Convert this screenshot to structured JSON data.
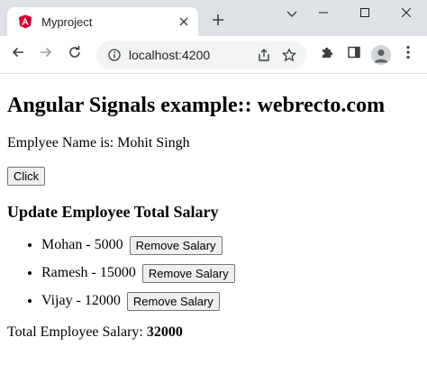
{
  "tab": {
    "title": "Myproject",
    "close_glyph": "✕",
    "favicon_icon": "angular-icon"
  },
  "new_tab": {
    "glyph": "+"
  },
  "window_controls": {
    "tab_search_icon": "chevron-down-icon",
    "minimize_icon": "minimize-icon",
    "maximize_icon": "maximize-icon",
    "close_icon": "close-icon"
  },
  "toolbar": {
    "url": "localhost:4200",
    "icons": [
      "back-icon",
      "forward-icon",
      "reload-icon",
      "info-icon",
      "share-icon",
      "star-icon",
      "extensions-icon",
      "side-panel-icon",
      "profile-icon",
      "menu-icon"
    ]
  },
  "page": {
    "heading": "Angular Signals example:: webrecto.com",
    "employee_label": "Emplyee Name is: Mohit Singh",
    "click_button": "Click",
    "subheading": "Update Employee Total Salary",
    "employees": [
      {
        "label": "Mohan - 5000",
        "button": "Remove Salary"
      },
      {
        "label": "Ramesh - 15000",
        "button": "Remove Salary"
      },
      {
        "label": "Vijay - 12000",
        "button": "Remove Salary"
      }
    ],
    "total_label": "Total Employee Salary: ",
    "total_value": "32000"
  },
  "colors": {
    "tabstrip": "#dee1e6",
    "omnibox": "#f1f3f4",
    "angular_red": "#dd0031"
  }
}
